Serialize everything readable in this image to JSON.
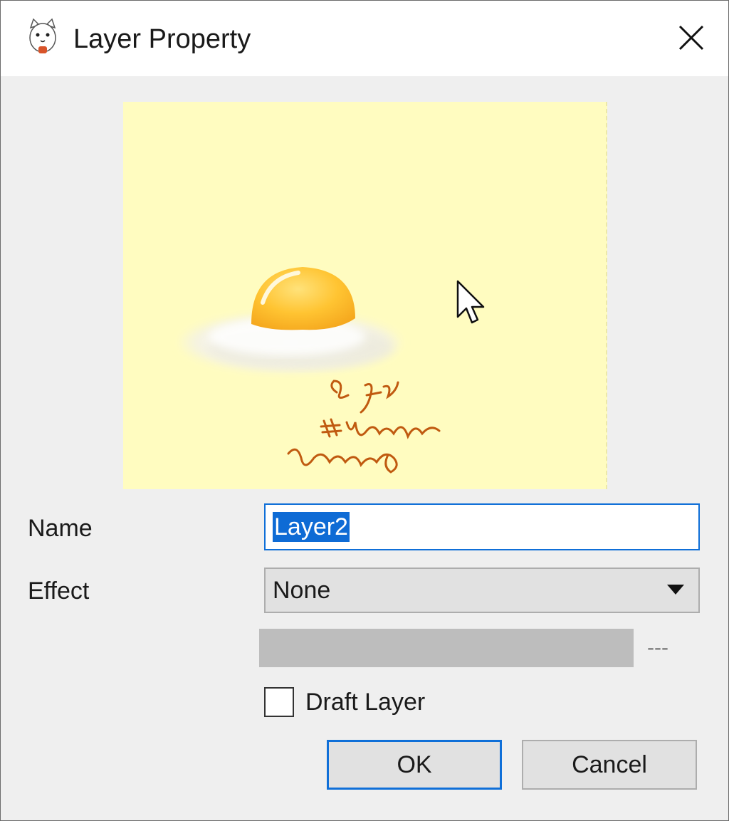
{
  "window": {
    "title": "Layer Property",
    "icon": "cat-app-icon",
    "close_icon": "close-icon"
  },
  "preview": {
    "background_color": "#fffcc0",
    "signature_color": "#c05a10"
  },
  "form": {
    "name_label": "Name",
    "name_value": "Layer2",
    "effect_label": "Effect",
    "effect_value": "None",
    "param_value": "---",
    "draft_label": "Draft Layer",
    "draft_checked": false
  },
  "buttons": {
    "ok_label": "OK",
    "cancel_label": "Cancel"
  },
  "colors": {
    "accent": "#0f6fd8",
    "selection": "#0e6bd5"
  }
}
